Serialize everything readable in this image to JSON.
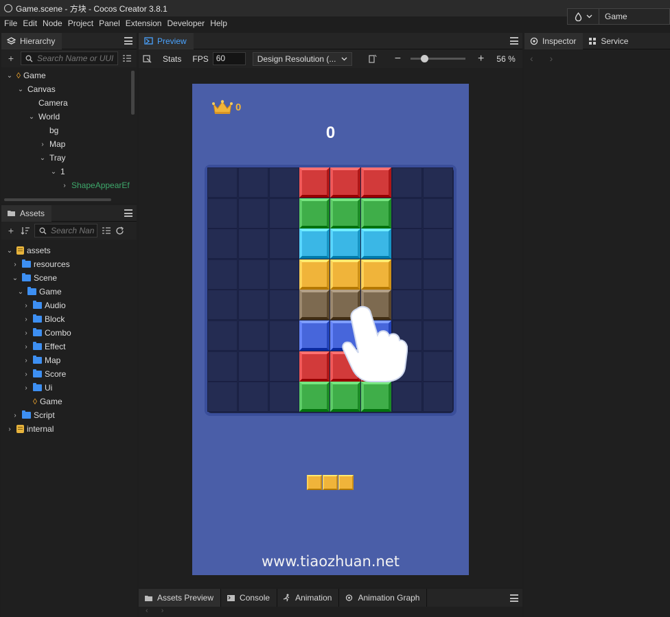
{
  "window": {
    "title": "Game.scene - 方块 - Cocos Creator 3.8.1"
  },
  "menu": [
    "File",
    "Edit",
    "Node",
    "Project",
    "Panel",
    "Extension",
    "Developer",
    "Help"
  ],
  "scene_selector": {
    "value": "Game"
  },
  "hierarchy": {
    "tab": "Hierarchy",
    "search_placeholder": "Search Name or UUI",
    "nodes": [
      {
        "label": "Game",
        "depth": 0,
        "caret": "open",
        "icon": "cocos-icon"
      },
      {
        "label": "Canvas",
        "depth": 1,
        "caret": "open"
      },
      {
        "label": "Camera",
        "depth": 2,
        "caret": "none"
      },
      {
        "label": "World",
        "depth": 2,
        "caret": "open"
      },
      {
        "label": "bg",
        "depth": 3,
        "caret": "none"
      },
      {
        "label": "Map",
        "depth": 3,
        "caret": "closed"
      },
      {
        "label": "Tray",
        "depth": 3,
        "caret": "open"
      },
      {
        "label": "1",
        "depth": 4,
        "caret": "open"
      },
      {
        "label": "ShapeAppearEf",
        "depth": 5,
        "caret": "closed",
        "color": "#3ea86b"
      }
    ]
  },
  "assets": {
    "tab": "Assets",
    "search_placeholder": "Search Nan",
    "tree": [
      {
        "label": "assets",
        "depth": 0,
        "caret": "open",
        "icon": "database-icon"
      },
      {
        "label": "resources",
        "depth": 1,
        "caret": "closed",
        "icon": "folder-icon"
      },
      {
        "label": "Scene",
        "depth": 1,
        "caret": "open",
        "icon": "folder-open-icon"
      },
      {
        "label": "Game",
        "depth": 2,
        "caret": "open",
        "icon": "folder-open-icon"
      },
      {
        "label": "Audio",
        "depth": 3,
        "caret": "closed",
        "icon": "folder-icon"
      },
      {
        "label": "Block",
        "depth": 3,
        "caret": "closed",
        "icon": "folder-icon"
      },
      {
        "label": "Combo",
        "depth": 3,
        "caret": "closed",
        "icon": "folder-icon"
      },
      {
        "label": "Effect",
        "depth": 3,
        "caret": "closed",
        "icon": "folder-icon"
      },
      {
        "label": "Map",
        "depth": 3,
        "caret": "closed",
        "icon": "folder-icon"
      },
      {
        "label": "Score",
        "depth": 3,
        "caret": "closed",
        "icon": "folder-icon"
      },
      {
        "label": "Ui",
        "depth": 3,
        "caret": "closed",
        "icon": "folder-icon"
      },
      {
        "label": "Game",
        "depth": 3,
        "caret": "none",
        "icon": "scene-icon"
      },
      {
        "label": "Script",
        "depth": 1,
        "caret": "closed",
        "icon": "folder-icon"
      },
      {
        "label": "internal",
        "depth": 0,
        "caret": "closed",
        "icon": "database-icon"
      }
    ]
  },
  "preview": {
    "tab": "Preview",
    "stats_label": "Stats",
    "fps_label": "FPS",
    "fps_value": "60",
    "resolution": "Design Resolution (...",
    "zoom": "56 %",
    "zoom_level": 0.25
  },
  "game": {
    "crown_count": "0",
    "score": "0",
    "watermark": "www.tiaozhuan.net",
    "colors": {
      "red": "#d23a3a",
      "green": "#3fae49",
      "cyan": "#3ab7e6",
      "yellow": "#f0b43a",
      "brown": "#7d6a50",
      "blue": "#4766db"
    },
    "grid_rows": [
      [
        "",
        "",
        "",
        "red",
        "red",
        "red",
        "",
        ""
      ],
      [
        "",
        "",
        "",
        "green",
        "green",
        "green",
        "",
        ""
      ],
      [
        "",
        "",
        "",
        "cyan",
        "cyan",
        "cyan",
        "",
        ""
      ],
      [
        "",
        "",
        "",
        "yellow",
        "yellow",
        "yellow",
        "",
        ""
      ],
      [
        "",
        "",
        "",
        "brown",
        "brown",
        "brown",
        "",
        ""
      ],
      [
        "",
        "",
        "",
        "blue",
        "blue",
        "blue",
        "",
        ""
      ],
      [
        "",
        "",
        "",
        "red",
        "red",
        "red",
        "",
        ""
      ],
      [
        "",
        "",
        "",
        "green",
        "green",
        "green",
        "",
        ""
      ]
    ],
    "tray_piece": [
      "yellow",
      "yellow",
      "yellow"
    ]
  },
  "inspector": {
    "tab": "Inspector",
    "service_tab": "Service"
  },
  "bottom_tabs": [
    "Assets Preview",
    "Console",
    "Animation",
    "Animation Graph"
  ]
}
